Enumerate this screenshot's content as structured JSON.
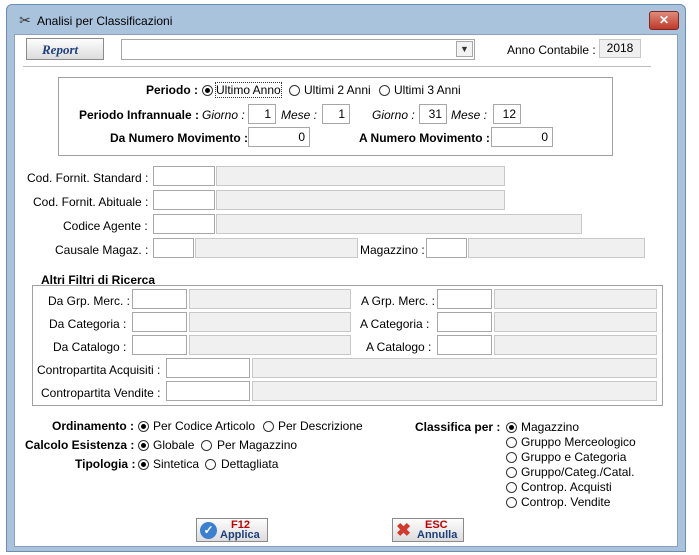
{
  "window": {
    "title": "Analisi per Classificazioni",
    "close_label": "✕"
  },
  "toolbar": {
    "report_label": "Report",
    "report_combo_value": "",
    "anno_label": "Anno Contabile :",
    "anno_value": "2018"
  },
  "periodo": {
    "label": "Periodo :",
    "options": [
      "Ultimo Anno",
      "Ultimi 2 Anni",
      "Ultimi 3 Anni"
    ],
    "infra_label": "Periodo Infrannuale :",
    "giorno_label": "Giorno :",
    "mese_label": "Mese :",
    "giorno1": "1",
    "mese1": "1",
    "giorno2": "31",
    "mese2": "12",
    "da_num_label": "Da Numero Movimento :",
    "da_num_value": "0",
    "a_num_label": "A Numero Movimento :",
    "a_num_value": "0"
  },
  "codes": {
    "fornit_std_label": "Cod. Fornit. Standard :",
    "fornit_abit_label": "Cod. Fornit. Abituale :",
    "agente_label": "Codice Agente :",
    "causale_label": "Causale Magaz. :",
    "magazzino_label": "Magazzino :"
  },
  "altri": {
    "title": "Altri Filtri di Ricerca",
    "da_grp_label": "Da Grp. Merc. :",
    "a_grp_label": "A Grp. Merc. :",
    "da_cat_label": "Da Categoria :",
    "a_cat_label": "A  Categoria :",
    "da_catalogo_label": "Da Catalogo :",
    "a_catalogo_label": "A Catalogo :",
    "cp_acq_label": "Contropartita Acquisiti :",
    "cp_vend_label": "Contropartita Vendite :"
  },
  "options": {
    "ordinamento_label": "Ordinamento :",
    "ordinamento": [
      "Per Codice Articolo",
      "Per Descrizione"
    ],
    "calcolo_label": "Calcolo Esistenza :",
    "calcolo": [
      "Globale",
      "Per Magazzino"
    ],
    "tipologia_label": "Tipologia :",
    "tipologia": [
      "Sintetica",
      "Dettagliata"
    ],
    "classifica_label": "Classifica per :",
    "classifica": [
      "Magazzino",
      "Gruppo Merceologico",
      "Gruppo e Categoria",
      "Gruppo/Categ./Catal.",
      "Controp. Acquisti",
      "Controp. Vendite"
    ]
  },
  "footer": {
    "apply_key": "F12",
    "apply_label": "Applica",
    "cancel_key": "ESC",
    "cancel_label": "Annulla"
  },
  "colors": {
    "frame": "#a9c3dc",
    "close": "#c0392b",
    "accent_red": "#c00000",
    "apply_icon": "#3a7fd0"
  }
}
